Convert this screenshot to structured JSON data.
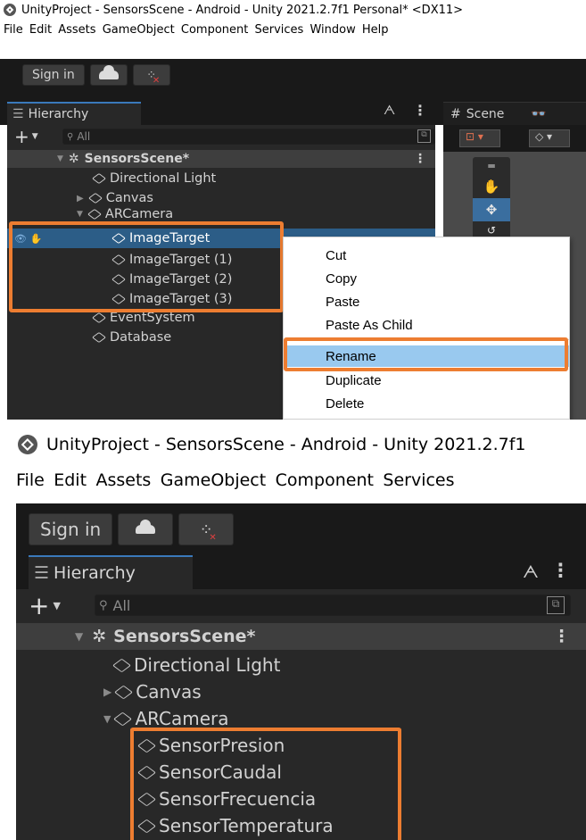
{
  "top": {
    "title": "UnityProject - SensorsScene - Android - Unity 2021.2.7f1 Personal* <DX11>",
    "menu": [
      "File",
      "Edit",
      "Assets",
      "GameObject",
      "Component",
      "Services",
      "Window",
      "Help"
    ],
    "sign_in": "Sign in",
    "hierarchy_tab": "Hierarchy",
    "scene_tab": "Scene",
    "search_placeholder": "All",
    "scene_name": "SensorsScene*",
    "tree": [
      "Directional Light",
      "Canvas",
      "ARCamera",
      "ImageTarget",
      "ImageTarget (1)",
      "ImageTarget (2)",
      "ImageTarget (3)",
      "EventSystem",
      "Database"
    ],
    "context_menu": [
      "Cut",
      "Copy",
      "Paste",
      "Paste As Child",
      "Rename",
      "Duplicate",
      "Delete"
    ],
    "highlighted_item": "Rename"
  },
  "bottom": {
    "title": "UnityProject - SensorsScene - Android - Unity 2021.2.7f1",
    "menu": [
      "File",
      "Edit",
      "Assets",
      "GameObject",
      "Component",
      "Services"
    ],
    "sign_in": "Sign in",
    "hierarchy_tab": "Hierarchy",
    "search_placeholder": "All",
    "scene_name": "SensorsScene*",
    "tree": [
      "Directional Light",
      "Canvas",
      "ARCamera",
      "SensorPresion",
      "SensorCaudal",
      "SensorFrecuencia",
      "SensorTemperatura"
    ]
  },
  "colors": {
    "highlight_border": "#ed7d31",
    "selection": "#2c5d87",
    "menu_highlight": "#99c9ef"
  }
}
